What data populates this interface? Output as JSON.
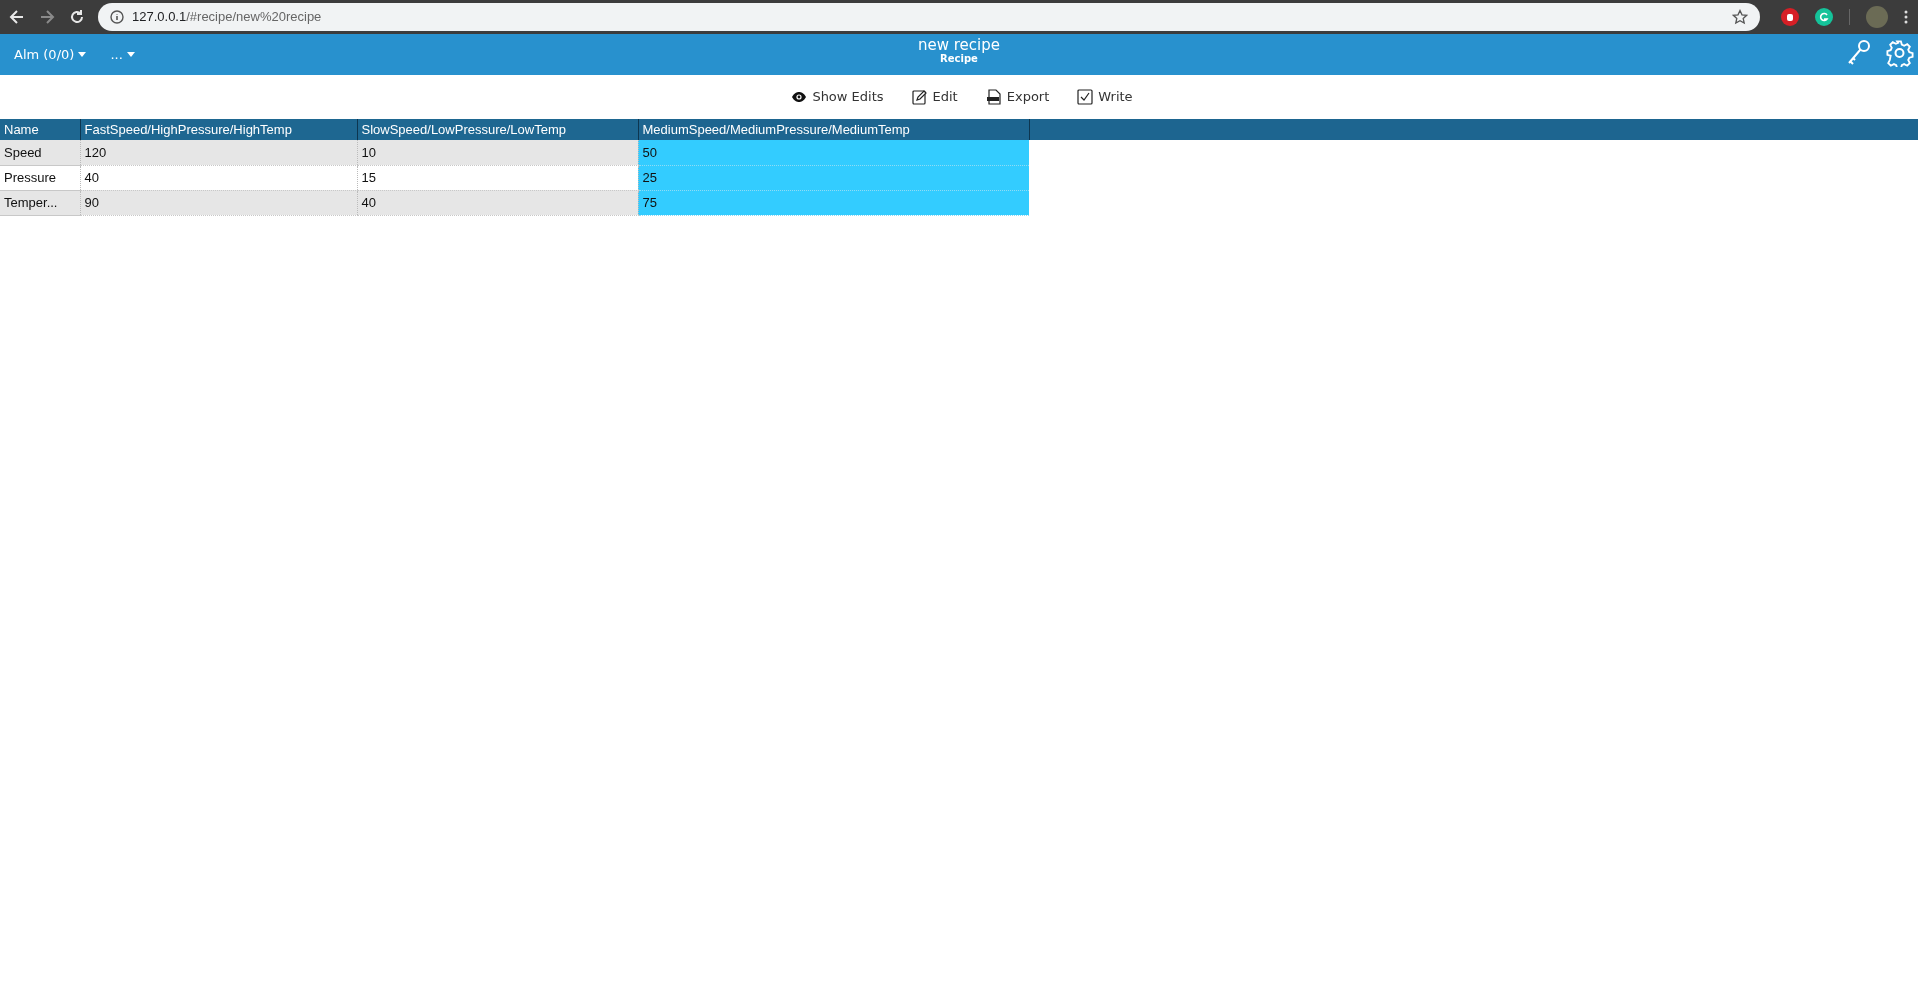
{
  "browser": {
    "url_host": "127.0.0.1",
    "url_path": "/#recipe/new%20recipe"
  },
  "header": {
    "menus": [
      {
        "label": "Alm (0/0)"
      },
      {
        "label": "..."
      }
    ],
    "title": "new recipe",
    "subtitle": "Recipe"
  },
  "toolbar": [
    {
      "kind": "eye",
      "label": "Show Edits"
    },
    {
      "kind": "pencil",
      "label": "Edit"
    },
    {
      "kind": "export",
      "label": "Export"
    },
    {
      "kind": "check",
      "label": "Write"
    }
  ],
  "table": {
    "columns": [
      {
        "label": "Name",
        "selected": false
      },
      {
        "label": "FastSpeed/HighPressure/HighTemp",
        "selected": false
      },
      {
        "label": "SlowSpeed/LowPressure/LowTemp",
        "selected": false
      },
      {
        "label": "MediumSpeed/MediumPressure/MediumTemp",
        "selected": true
      }
    ],
    "rows": [
      [
        "Speed",
        "120",
        "10",
        "50"
      ],
      [
        "Pressure",
        "40",
        "15",
        "25"
      ],
      [
        "Temper...",
        "90",
        "40",
        "75"
      ]
    ]
  }
}
